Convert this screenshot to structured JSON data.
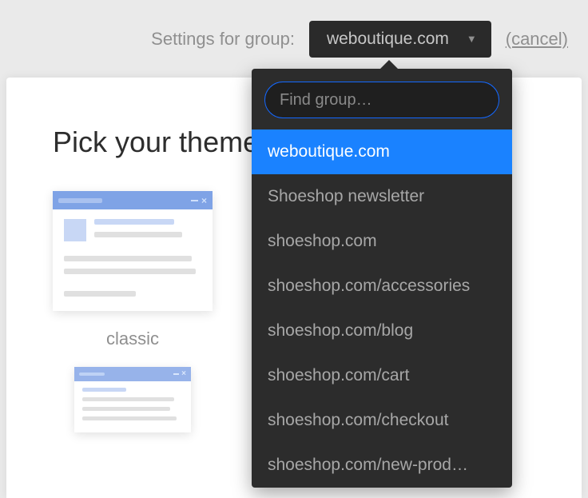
{
  "topbar": {
    "settings_label": "Settings for group:",
    "selected_group": "weboutique.com",
    "cancel_label": "(cancel)"
  },
  "main": {
    "title": "Pick your theme",
    "themes": [
      {
        "label": "classic"
      }
    ]
  },
  "dropdown": {
    "search_placeholder": "Find group…",
    "options": [
      {
        "label": "weboutique.com",
        "selected": true
      },
      {
        "label": "Shoeshop newsletter",
        "selected": false
      },
      {
        "label": "shoeshop.com",
        "selected": false
      },
      {
        "label": "shoeshop.com/accessories",
        "selected": false
      },
      {
        "label": "shoeshop.com/blog",
        "selected": false
      },
      {
        "label": "shoeshop.com/cart",
        "selected": false
      },
      {
        "label": "shoeshop.com/checkout",
        "selected": false
      },
      {
        "label": "shoeshop.com/new-prod…",
        "selected": false
      }
    ]
  },
  "colors": {
    "accent": "#1a82ff",
    "panel": "#2c2c2c"
  }
}
